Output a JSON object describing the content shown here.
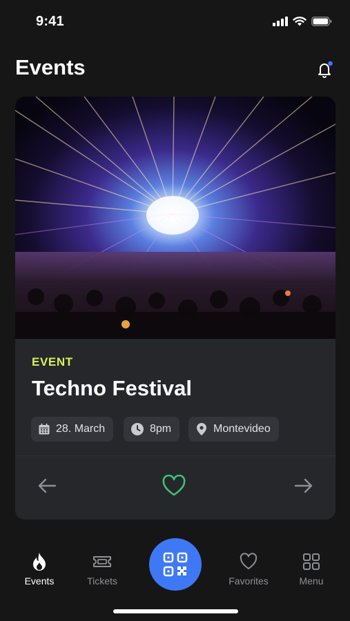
{
  "status_bar": {
    "time": "9:41"
  },
  "header": {
    "title": "Events"
  },
  "card": {
    "eyebrow": "EVENT",
    "title": "Techno Festival",
    "chips": {
      "date": "28. March",
      "time": "8pm",
      "location": "Montevideo"
    }
  },
  "tabs": {
    "events": "Events",
    "tickets": "Tickets",
    "favorites": "Favorites",
    "menu": "Menu"
  },
  "colors": {
    "accent": "#3f78f5",
    "eyebrow": "#d8f05a",
    "favorite": "#3fbf76",
    "notification_dot": "#3f78f5"
  },
  "icons": [
    "signal-icon",
    "wifi-icon",
    "battery-icon",
    "bell-icon",
    "calendar-icon",
    "clock-icon",
    "location-pin-icon",
    "arrow-left-icon",
    "heart-icon",
    "arrow-right-icon",
    "flame-icon",
    "ticket-icon",
    "qr-code-icon",
    "heart-outline-icon",
    "grid-icon"
  ]
}
